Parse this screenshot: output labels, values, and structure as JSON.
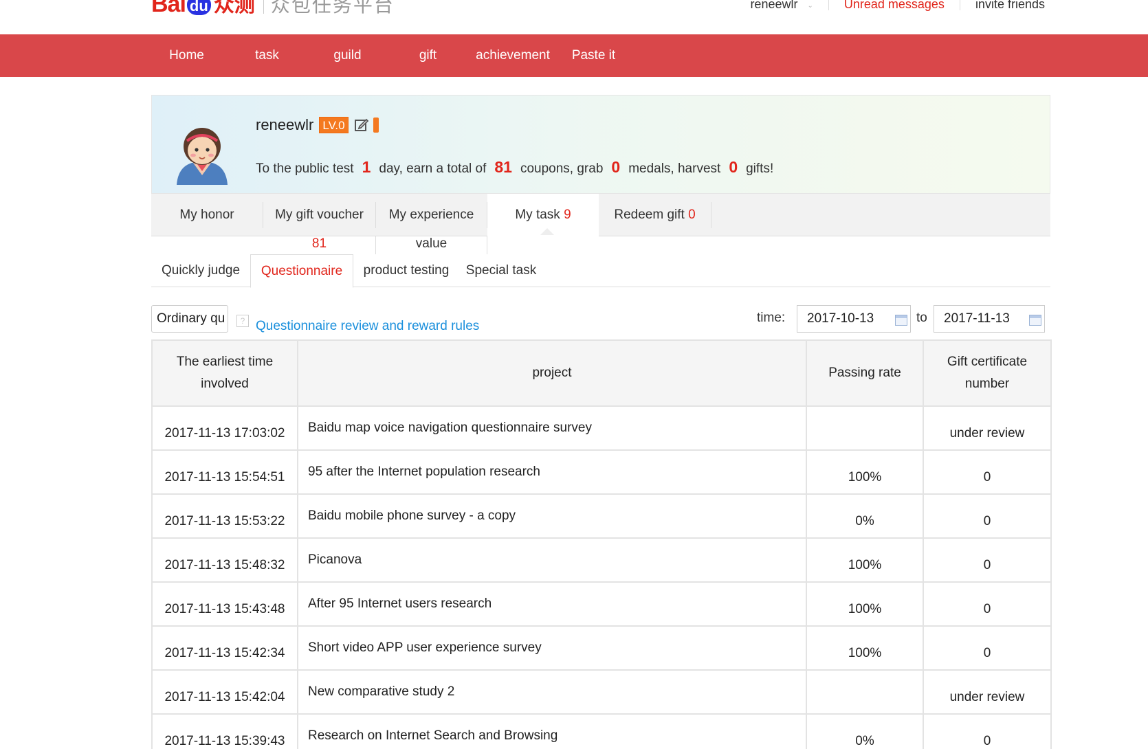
{
  "header": {
    "logo": {
      "bai": "Bai",
      "du": "du",
      "zhongce": "众测",
      "subtitle": "众包任务平台"
    },
    "user": "reneewlr",
    "unread": "Unread messages",
    "invite": "invite friends"
  },
  "nav": [
    "Home",
    "task",
    "guild",
    "gift",
    "achievement",
    "Paste it"
  ],
  "profile": {
    "name": "reneewlr",
    "level": "LV.0",
    "stats": {
      "t1": "To the public test",
      "days": "1",
      "t2": "day, earn a total of",
      "coupons": "81",
      "t3": "coupons, grab",
      "medals": "0",
      "t4": "medals, harvest",
      "gifts": "0",
      "t5": "gifts!"
    }
  },
  "tabs": {
    "honor": "My honor",
    "voucher": "My gift voucher",
    "voucher_count": "81",
    "experience_a": "My experience",
    "experience_b": "value",
    "task": "My task",
    "task_count": "9",
    "redeem": "Redeem gift",
    "redeem_count": "0"
  },
  "subtabs": [
    "Quickly judge",
    "Questionnaire",
    "product testing",
    "Special task"
  ],
  "filter": {
    "select_value": "Ordinary qu",
    "rules_link": "Questionnaire review and reward rules",
    "time_label": "time:",
    "from": "2017-10-13",
    "to_label": "to",
    "to": "2017-11-13"
  },
  "table": {
    "headers": {
      "time_a": "The earliest time",
      "time_b": "involved",
      "project": "project",
      "rate": "Passing rate",
      "cert_a": "Gift certificate",
      "cert_b": "number"
    },
    "rows": [
      {
        "time": "2017-11-13 17:03:02",
        "project": "Baidu map voice navigation questionnaire survey",
        "rate": "",
        "cert": "under review"
      },
      {
        "time": "2017-11-13 15:54:51",
        "project": "95 after the Internet population research",
        "rate": "100%",
        "cert": "0"
      },
      {
        "time": "2017-11-13 15:53:22",
        "project": "Baidu mobile phone survey - a copy",
        "rate": "0%",
        "cert": "0"
      },
      {
        "time": "2017-11-13 15:48:32",
        "project": "Picanova",
        "rate": "100%",
        "cert": "0"
      },
      {
        "time": "2017-11-13 15:43:48",
        "project": "After 95 Internet users research",
        "rate": "100%",
        "cert": "0"
      },
      {
        "time": "2017-11-13 15:42:34",
        "project": "Short video APP user experience survey",
        "rate": "100%",
        "cert": "0"
      },
      {
        "time": "2017-11-13 15:42:04",
        "project": "New comparative study 2",
        "rate": "",
        "cert": "under review"
      },
      {
        "time": "2017-11-13 15:39:43",
        "project": "Research on Internet Search and Browsing",
        "rate": "0%",
        "cert": "0"
      }
    ]
  },
  "colors": {
    "nav_red": "#d9474a",
    "accent_red": "#e1251b",
    "link_blue": "#1a8fdc",
    "level_orange": "#f47920"
  }
}
